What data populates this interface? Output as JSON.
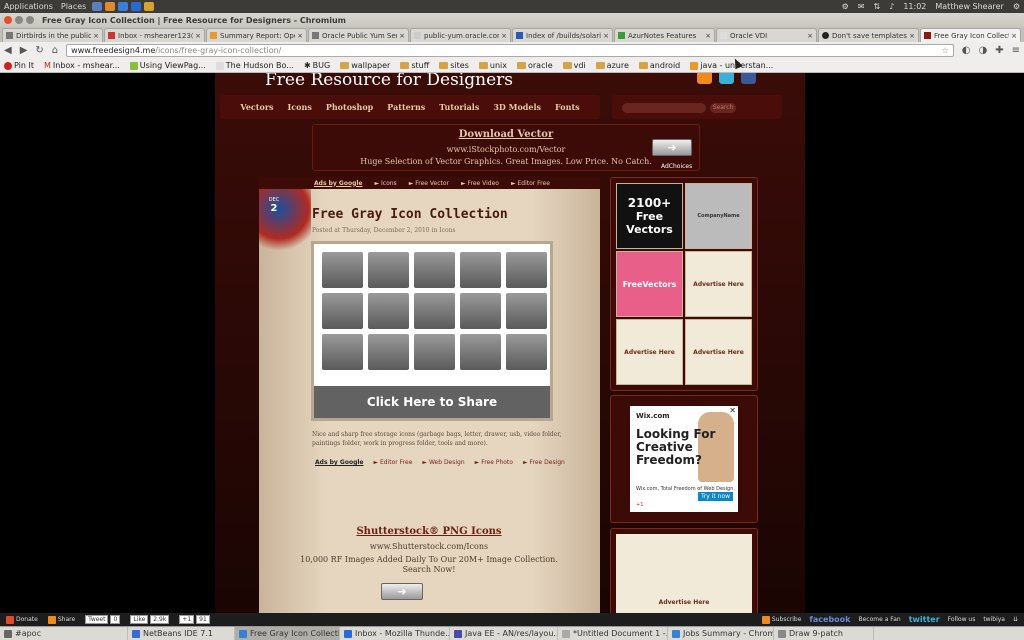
{
  "topbar": {
    "apps": [
      "Applications",
      "Places"
    ],
    "time": "11:02",
    "user": "Matthew Shearer"
  },
  "window": {
    "title": "Free Gray Icon Collection | Free Resource for Designers - Chromium"
  },
  "tabs": [
    {
      "label": "Dirtbirds in the public e"
    },
    {
      "label": "Inbox - mshearer123@g"
    },
    {
      "label": "Summary Report: Open I"
    },
    {
      "label": "Oracle Public Yum Serve"
    },
    {
      "label": "public-yum.oracle.com/"
    },
    {
      "label": "Index of /builds/solaris/"
    },
    {
      "label": "AzurNotes Features"
    },
    {
      "label": "Oracle VDI"
    },
    {
      "label": "Don't save templates th"
    },
    {
      "label": "Free Gray Icon Collection"
    }
  ],
  "address": {
    "host": "www.freedesign4.me",
    "path": "/icons/free-gray-icon-collection/"
  },
  "bookmarks": [
    "Pin It",
    "Inbox - mshear...",
    "Using ViewPag...",
    "The Hudson Bo...",
    "BUG",
    "wallpaper",
    "stuff",
    "sites",
    "unix",
    "oracle",
    "vdi",
    "azure",
    "android",
    "java - understan..."
  ],
  "site": {
    "title": "Free Resource for Designers",
    "nav": [
      "Vectors",
      "Icons",
      "Photoshop",
      "Patterns",
      "Tutorials",
      "3D Models",
      "Fonts"
    ],
    "search_btn": "Search"
  },
  "ad_top": {
    "headline": "Download Vector",
    "url": "www.iStockphoto.com/Vector",
    "desc": "Huge Selection of Vector Graphics. Great Images. Low Price. No Catch.",
    "adchoices": "AdChoices"
  },
  "adlinks": [
    "Ads by Google",
    "Icons",
    "Free Vector",
    "Free Video",
    "Editor Free"
  ],
  "post": {
    "month": "DEC",
    "day": "2",
    "title": "Free Gray Icon Collection",
    "meta": "Posted at Thursday, December 2, 2010 in Icons",
    "share": "Click Here to Share",
    "desc": "Nice and sharp free storage icons (garbage bags, letter, drawer, usb, video folder, paintings folder, work in progress folder, tools and more)."
  },
  "adlinks2": [
    "Ads by Google",
    "Editor Free",
    "Web Design",
    "Free Photo",
    "Free Design"
  ],
  "ad_bottom": {
    "headline": "Shutterstock® PNG Icons",
    "url": "www.Shutterstock.com/Icons",
    "desc": "10,000 RF Images Added Daily To Our 20M+ Image Collection. Search Now!"
  },
  "sidebar": {
    "vec_count": "2100+",
    "vec_label": "Free",
    "vec_label2": "Vectors",
    "card": "CompanyName",
    "fv": "FreeVectors",
    "adv": "Advertise Here"
  },
  "wix": {
    "logo": "Wix.com",
    "headline": "Looking For Creative Freedom?",
    "sub": "Wix.com, Total Freedom of Web Design.",
    "try": "Try it now",
    "plus": "+1"
  },
  "bottombar": {
    "donate": "Donate",
    "share": "Share",
    "tweet": "Tweet",
    "tweet_count": "0",
    "like": "Like",
    "like_count": "2.9k",
    "plus": "+1",
    "plus_count": "91",
    "subscribe": "Subscribe",
    "facebook": "facebook",
    "fan": "Become a Fan",
    "twitter": "twitter",
    "follow": "Follow us",
    "powered": "twibiya"
  },
  "taskbar": [
    "#apoc",
    "NetBeans IDE 7.1",
    "Free Gray Icon Collecti...",
    "Inbox - Mozilla Thunde...",
    "Java EE - AN/res/layou...",
    "*Untitled Document 1 -...",
    "Jobs Summary - Chrom...",
    "Draw 9-patch"
  ]
}
